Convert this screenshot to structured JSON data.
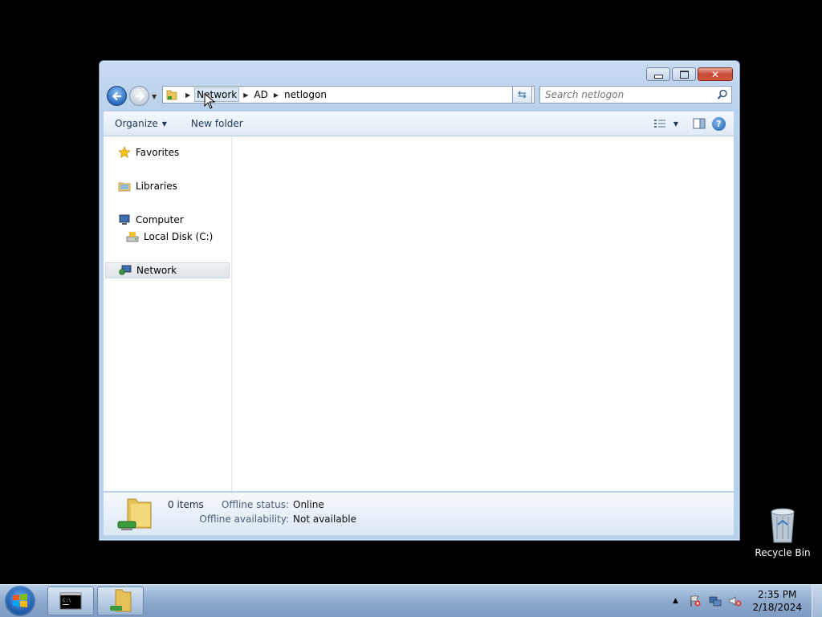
{
  "window": {
    "title": "netlogon",
    "breadcrumbs": [
      "Network",
      "AD",
      "netlogon"
    ],
    "search_placeholder": "Search netlogon",
    "toolbar": {
      "organize_label": "Organize",
      "new_folder_label": "New folder"
    }
  },
  "nav_pane": {
    "favorites": "Favorites",
    "libraries": "Libraries",
    "computer": "Computer",
    "local_disk": "Local Disk (C:)",
    "network": "Network"
  },
  "details": {
    "item_count": "0 items",
    "offline_status_label": "Offline status:",
    "offline_status_value": "Online",
    "offline_availability_label": "Offline availability:",
    "offline_availability_value": "Not available"
  },
  "desktop": {
    "recycle_bin_label": "Recycle Bin"
  },
  "taskbar": {
    "time": "2:35 PM",
    "date": "2/18/2024"
  },
  "colors": {
    "window_frame": "#b9d1ea",
    "selected_nav": "#dfe4ea",
    "taskbar": "#8eaacd"
  }
}
